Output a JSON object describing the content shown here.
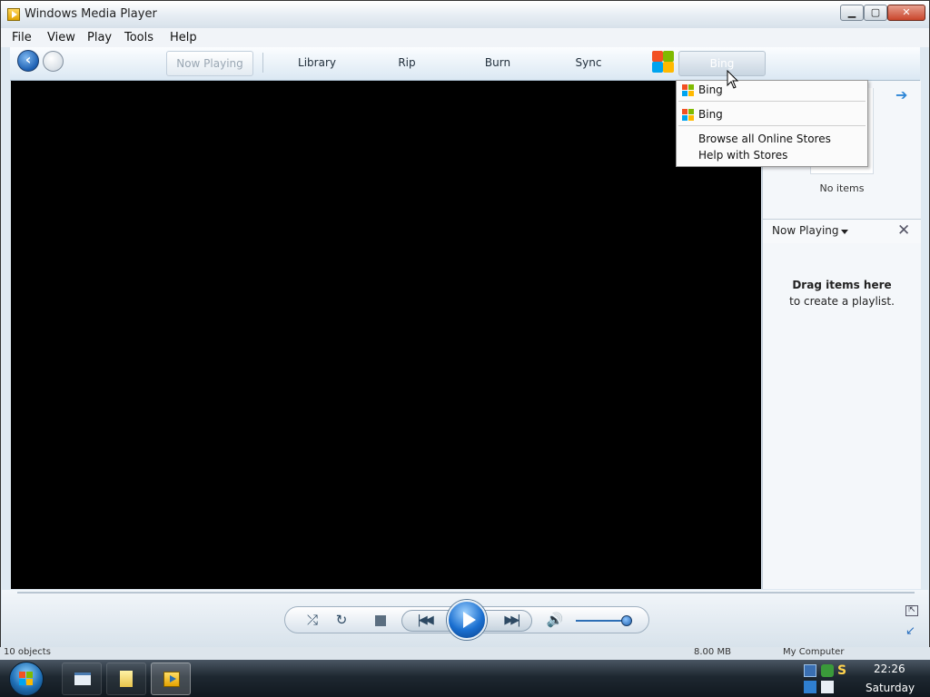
{
  "window": {
    "title": "Windows Media Player",
    "min": "▁",
    "max": "▢",
    "close": "✕"
  },
  "menu": [
    "File",
    "View",
    "Play",
    "Tools",
    "Help"
  ],
  "tabs": {
    "now_playing": "Now Playing",
    "library": "Library",
    "rip": "Rip",
    "burn": "Burn",
    "sync": "Sync",
    "stores": "Bing"
  },
  "stores_menu": {
    "items": [
      "Bing",
      "Bing"
    ],
    "browse": "Browse all Online Stores",
    "help": "Help with Stores"
  },
  "right_pane": {
    "no_items": "No items",
    "now_playing_label": "Now Playing",
    "drag_bold": "Drag items here",
    "drag_sub": "to create a playlist."
  },
  "controls": {
    "volume_level": 0.9
  },
  "status": {
    "left": "10 objects",
    "middle": "8.00 MB",
    "right": "My Computer"
  },
  "taskbar": {
    "time": "22:26",
    "day": "Saturday"
  },
  "colors": {
    "accent": "#1a6fd0",
    "video_bg": "#000000",
    "window_bg": "#dfe9f2"
  }
}
